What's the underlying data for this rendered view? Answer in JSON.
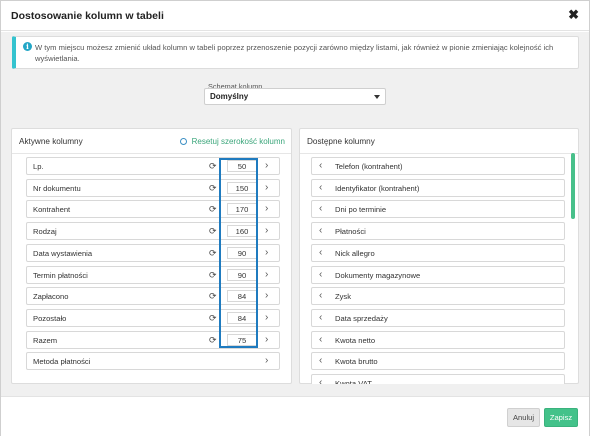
{
  "dialog": {
    "title": "Dostosowanie kolumn w tabeli",
    "close_label": "✖"
  },
  "info": {
    "icon": "info-icon",
    "text": "W tym miejscu możesz zmienić układ kolumn w tabeli poprzez przenoszenie pozycji zarówno między listami, jak również w pionie zmieniając kolejność ich wyświetlania."
  },
  "schema": {
    "label": "Schemat kolumn",
    "value": "Domyślny"
  },
  "active_panel": {
    "title": "Aktywne kolumny",
    "reset_label": "Resetuj szerokość kolumn",
    "columns": [
      {
        "label": "Lp.",
        "width": "50"
      },
      {
        "label": "Nr dokumentu",
        "width": "150"
      },
      {
        "label": "Kontrahent",
        "width": "170"
      },
      {
        "label": "Rodzaj",
        "width": "160"
      },
      {
        "label": "Data wystawienia",
        "width": "90"
      },
      {
        "label": "Termin płatności",
        "width": "90"
      },
      {
        "label": "Zapłacono",
        "width": "84"
      },
      {
        "label": "Pozostało",
        "width": "84"
      },
      {
        "label": "Razem",
        "width": "75"
      },
      {
        "label": "Metoda płatności",
        "width": ""
      }
    ]
  },
  "available_panel": {
    "title": "Dostępne kolumny",
    "columns": [
      {
        "label": "Telefon (kontrahent)"
      },
      {
        "label": "Identyfikator (kontrahent)"
      },
      {
        "label": "Dni po terminie"
      },
      {
        "label": "Płatności"
      },
      {
        "label": "Nick allegro"
      },
      {
        "label": "Dokumenty magazynowe"
      },
      {
        "label": "Zysk"
      },
      {
        "label": "Data sprzedaży"
      },
      {
        "label": "Kwota netto"
      },
      {
        "label": "Kwota brutto"
      },
      {
        "label": "Kwota VAT"
      }
    ]
  },
  "footer": {
    "cancel_label": "Anuluj",
    "save_label": "Zapisz"
  },
  "colors": {
    "accent_green": "#43c28a",
    "info_border": "#34c3cf",
    "highlight_outline": "#1f7bbf"
  }
}
